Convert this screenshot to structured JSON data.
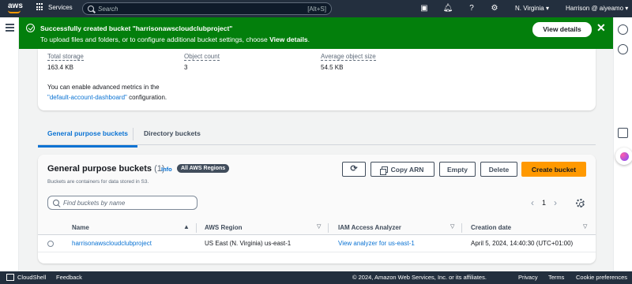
{
  "topnav": {
    "logo": "aws",
    "services_label": "Services",
    "search_placeholder": "Search",
    "search_shortcut": "[Alt+S]",
    "region": "N. Virginia ▾",
    "user": "Harrison @ aiyeamo ▾"
  },
  "flash": {
    "title": "Successfully created bucket \"harrisonawscloudclubproject\"",
    "message_prefix": "To upload files and folders, or to configure additional bucket settings, choose ",
    "message_bold": "View details",
    "message_suffix": ".",
    "button_label": "View details",
    "close_glyph": "✕"
  },
  "metrics": [
    {
      "label": "Total storage",
      "value": "163.4 KB"
    },
    {
      "label": "Object count",
      "value": "3"
    },
    {
      "label": "Average object size",
      "value": "54.5 KB"
    }
  ],
  "advanced_metrics": {
    "line1": "You can enable advanced metrics in the",
    "link": "\"default-account-dashboard\"",
    "line2_suffix": " configuration."
  },
  "tabs": [
    {
      "label": "General purpose buckets",
      "active": true
    },
    {
      "label": "Directory buckets",
      "active": false
    }
  ],
  "buckets_panel": {
    "title": "General purpose buckets",
    "count": "(1)",
    "info": "Info",
    "badge": "All AWS Regions",
    "description": "Buckets are containers for data stored in S3.",
    "buttons": {
      "refresh": "⟳",
      "copy_arn": "Copy ARN",
      "empty": "Empty",
      "delete": "Delete",
      "create": "Create bucket"
    },
    "filter_placeholder": "Find buckets by name",
    "pagination": {
      "prev": "‹",
      "page": "1",
      "next": "›"
    }
  },
  "table": {
    "columns": [
      "Name",
      "AWS Region",
      "IAM Access Analyzer",
      "Creation date"
    ],
    "rows": [
      {
        "name": "harrisonawscloudclubproject",
        "region": "US East (N. Virginia) us-east-1",
        "analyzer": "View analyzer for us-east-1",
        "created": "April 5, 2024, 14:40:30 (UTC+01:00)"
      }
    ]
  },
  "footer": {
    "cloudshell": "CloudShell",
    "feedback": "Feedback",
    "copyright": "© 2024, Amazon Web Services, Inc. or its affiliates.",
    "privacy": "Privacy",
    "terms": "Terms",
    "cookies": "Cookie preferences"
  },
  "colors": {
    "nav_bg": "#232f3e",
    "success_green": "#037f0c",
    "link_blue": "#0972d3",
    "primary_orange": "#ff9900"
  }
}
